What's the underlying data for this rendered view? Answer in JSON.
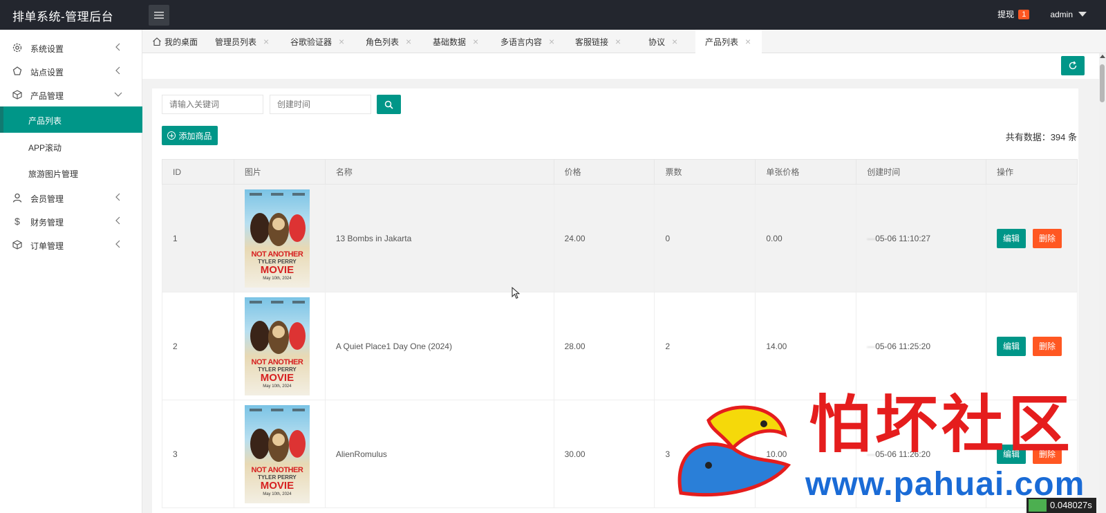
{
  "app": {
    "title": "排单系统-管理后台"
  },
  "header": {
    "withdraw_label": "提现",
    "withdraw_count": "1",
    "user_name": "admin"
  },
  "sidebar": {
    "items": [
      {
        "label": "系统设置",
        "icon": "gear-icon",
        "arrow": "chevron-left"
      },
      {
        "label": "站点设置",
        "icon": "site-icon",
        "arrow": "chevron-left"
      },
      {
        "label": "产品管理",
        "icon": "box-icon",
        "arrow": "chevron-down"
      },
      {
        "label": "会员管理",
        "icon": "user-icon",
        "arrow": "chevron-left"
      },
      {
        "label": "财务管理",
        "icon": "dollar-icon",
        "arrow": "chevron-left"
      },
      {
        "label": "订单管理",
        "icon": "order-icon",
        "arrow": "chevron-left"
      }
    ],
    "sub_items": [
      {
        "label": "产品列表",
        "active": true
      },
      {
        "label": "APP滚动",
        "active": false
      },
      {
        "label": "旅游图片管理",
        "active": false
      }
    ]
  },
  "tabs": [
    {
      "label": "我的桌面",
      "icon": "home-icon"
    },
    {
      "label": "管理员列表"
    },
    {
      "label": "谷歌验证器"
    },
    {
      "label": "角色列表"
    },
    {
      "label": "基础数据"
    },
    {
      "label": "多语言内容"
    },
    {
      "label": "客服链接"
    },
    {
      "label": "协议"
    },
    {
      "label": "产品列表",
      "active": true
    }
  ],
  "filters": {
    "keyword_placeholder": "请输入关键词",
    "date_placeholder": "创建时间"
  },
  "actions": {
    "add_label": "添加商品",
    "total_text": "共有数据：394 条"
  },
  "table": {
    "headers": [
      "ID",
      "图片",
      "名称",
      "价格",
      "票数",
      "单张价格",
      "创建时间",
      "操作"
    ],
    "edit_label": "编辑",
    "delete_label": "删除",
    "poster": {
      "line1": "NOT ANOTHER",
      "line2": "TYLER PERRY",
      "line3": "MOVIE",
      "line4": "May 10th, 2024"
    },
    "rows": [
      {
        "id": "1",
        "name": "13 Bombs in Jakarta",
        "price": "24.00",
        "votes": "0",
        "unit_price": "0.00",
        "time": "05-06 11:10:27"
      },
      {
        "id": "2",
        "name": "A Quiet Place1 Day One (2024)",
        "price": "28.00",
        "votes": "2",
        "unit_price": "14.00",
        "time": "05-06 11:25:20"
      },
      {
        "id": "3",
        "name": "AlienRomulus",
        "price": "30.00",
        "votes": "3",
        "unit_price": "10.00",
        "time": "05-06 11:26:20"
      }
    ]
  },
  "watermark": {
    "cn": "怕坏社区",
    "url": "www.pahuai.com"
  },
  "timer": "0.048027s",
  "colors": {
    "accent": "#009688",
    "danger": "#ff5722",
    "topbar": "#23262e"
  }
}
